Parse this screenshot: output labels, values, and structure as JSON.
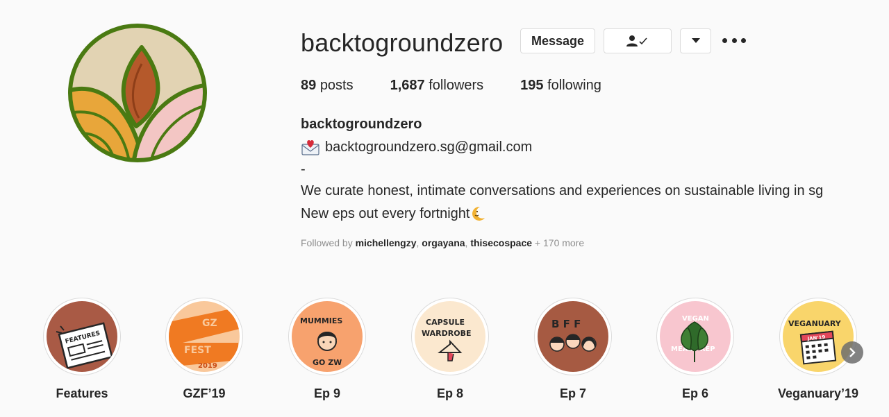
{
  "profile": {
    "username": "backtogroundzero",
    "buttons": {
      "message": "Message"
    },
    "stats": {
      "posts_count": "89",
      "posts_label": "posts",
      "followers_count": "1,687",
      "followers_label": "followers",
      "following_count": "195",
      "following_label": "following"
    },
    "full_name": "backtogroundzero",
    "email": "backtogroundzero.sg@gmail.com",
    "bio_dash": "-",
    "bio_line1": "We curate honest, intimate conversations and experiences on sustainable living in sg",
    "bio_line2": "New eps out every fortnight",
    "followed_by": {
      "prefix": "Followed by ",
      "users": [
        "michellengzy",
        "orgayana",
        "thisecospace"
      ],
      "sep": ", ",
      "more": " + 170 more"
    }
  },
  "highlights": [
    {
      "label": "Features",
      "art": "FEATURES"
    },
    {
      "label": "GZF’19",
      "art_lines": [
        "GZ",
        "FEST",
        "2019"
      ]
    },
    {
      "label": "Ep 9",
      "art_lines": [
        "MUMMIES",
        "GO ZW"
      ]
    },
    {
      "label": "Ep 8",
      "art_lines": [
        "CAPSULE",
        "WARDROBE"
      ]
    },
    {
      "label": "Ep 7",
      "art": "B F F"
    },
    {
      "label": "Ep 6",
      "art_lines": [
        "VEGAN",
        "MEAL PREP"
      ]
    },
    {
      "label": "Veganuary’19",
      "art_lines": [
        "VEGANUARY",
        "JAN'19"
      ]
    }
  ],
  "icons": {
    "following": "person-check-icon",
    "dropdown": "chevron-down-icon",
    "more": "more-options-icon",
    "email": "envelope-heart-icon",
    "moon": "crescent-moon-icon",
    "next": "chevron-right-icon"
  },
  "colors": {
    "logo_green": "#4a7a12",
    "logo_beige": "#e2d3b3",
    "logo_orange": "#e8a63a",
    "logo_brown": "#b5592b",
    "logo_pink": "#f3c6c4",
    "text": "#262626",
    "muted": "#8e8e8e"
  }
}
